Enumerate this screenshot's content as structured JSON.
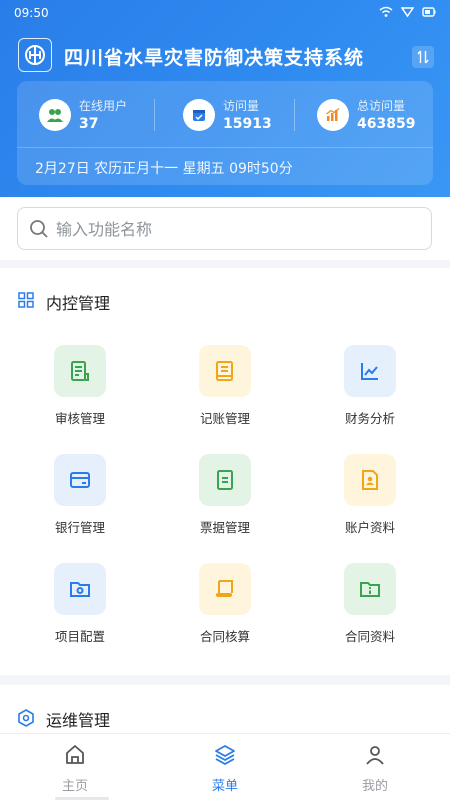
{
  "status_bar": {
    "time": "09:50"
  },
  "header": {
    "title": "四川省水旱灾害防御决策支持系统",
    "stats": [
      {
        "label": "在线用户",
        "value": "37",
        "icon": "users-icon"
      },
      {
        "label": "访问量",
        "value": "15913",
        "icon": "calendar-check-icon"
      },
      {
        "label": "总访问量",
        "value": "463859",
        "icon": "bar-chart-icon"
      }
    ],
    "date_line": "2月27日 农历正月十一 星期五 09时50分"
  },
  "search": {
    "placeholder": "输入功能名称"
  },
  "sections": [
    {
      "title": "内控管理",
      "items": [
        {
          "label": "审核管理",
          "icon": "audit-document-icon"
        },
        {
          "label": "记账管理",
          "icon": "ledger-book-icon"
        },
        {
          "label": "财务分析",
          "icon": "line-chart-icon"
        },
        {
          "label": "银行管理",
          "icon": "bank-card-icon"
        },
        {
          "label": "票据管理",
          "icon": "invoice-icon"
        },
        {
          "label": "账户资料",
          "icon": "account-profile-icon"
        },
        {
          "label": "项目配置",
          "icon": "folder-settings-icon"
        },
        {
          "label": "合同核算",
          "icon": "contract-scroll-icon"
        },
        {
          "label": "合同资料",
          "icon": "info-folder-icon"
        }
      ]
    },
    {
      "title": "运维管理"
    }
  ],
  "tabbar": {
    "tabs": [
      {
        "label": "主页",
        "icon": "home-icon"
      },
      {
        "label": "菜单",
        "icon": "layers-icon",
        "active": true
      },
      {
        "label": "我的",
        "icon": "user-icon"
      }
    ]
  },
  "colors": {
    "brand": "#2a7de8",
    "green_tile": "#e3f3e6",
    "green_icon": "#3aa34f",
    "yellow_tile": "#fff5dc",
    "yellow_icon": "#f0a619",
    "blue_tile": "#e6f0fd",
    "blue_icon": "#2a7de8"
  }
}
